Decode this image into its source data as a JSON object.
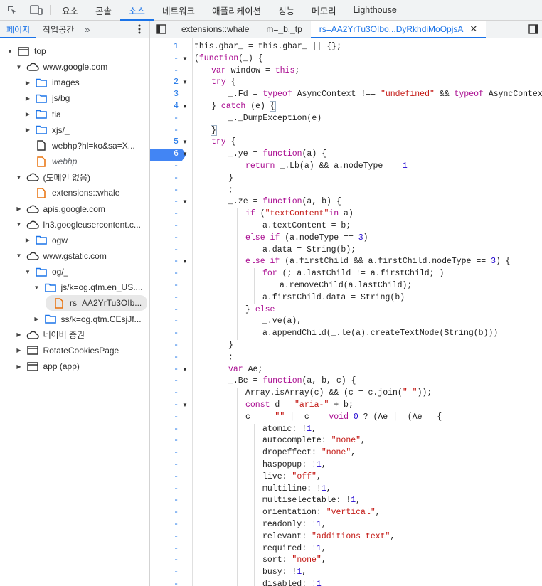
{
  "topbar": {
    "tabs": [
      "요소",
      "콘솔",
      "소스",
      "네트워크",
      "애플리케이션",
      "성능",
      "메모리",
      "Lighthouse"
    ],
    "active_index": 2
  },
  "left_panel": {
    "tabs": [
      "페이지",
      "작업공간"
    ],
    "active_index": 0,
    "more_label": "»"
  },
  "editor_tabs": {
    "files": [
      "extensions::whale",
      "m=_b,_tp",
      "rs=AA2YrTu3OIbo...DyRkhdiMoOpjsA"
    ],
    "active_index": 2,
    "close_label": "✕"
  },
  "tree": [
    {
      "label": "top",
      "icon": "frame-icon",
      "depth": 0,
      "arrow": "down"
    },
    {
      "label": "www.google.com",
      "icon": "cloud-icon",
      "depth": 1,
      "arrow": "down"
    },
    {
      "label": "images",
      "icon": "folder-icon",
      "depth": 2,
      "arrow": "right"
    },
    {
      "label": "js/bg",
      "icon": "folder-icon",
      "depth": 2,
      "arrow": "right"
    },
    {
      "label": "tia",
      "icon": "folder-icon",
      "depth": 2,
      "arrow": "right"
    },
    {
      "label": "xjs/_",
      "icon": "folder-icon",
      "depth": 2,
      "arrow": "right"
    },
    {
      "label": "webhp?hl=ko&sa=X...",
      "icon": "file-icon",
      "depth": 2,
      "arrow": "none"
    },
    {
      "label": "webhp",
      "icon": "script-file-icon",
      "depth": 2,
      "arrow": "none",
      "italic": true
    },
    {
      "label": "(도메인 없음)",
      "icon": "cloud-icon",
      "depth": 1,
      "arrow": "down"
    },
    {
      "label": "extensions::whale",
      "icon": "script-file-icon",
      "depth": 2,
      "arrow": "none"
    },
    {
      "label": "apis.google.com",
      "icon": "cloud-icon",
      "depth": 1,
      "arrow": "right"
    },
    {
      "label": "lh3.googleusercontent.c...",
      "icon": "cloud-icon",
      "depth": 1,
      "arrow": "down"
    },
    {
      "label": "ogw",
      "icon": "folder-icon",
      "depth": 2,
      "arrow": "right"
    },
    {
      "label": "www.gstatic.com",
      "icon": "cloud-icon",
      "depth": 1,
      "arrow": "down"
    },
    {
      "label": "og/_",
      "icon": "folder-icon",
      "depth": 2,
      "arrow": "down"
    },
    {
      "label": "js/k=og.qtm.en_US....",
      "icon": "folder-icon",
      "depth": 3,
      "arrow": "down"
    },
    {
      "label": "rs=AA2YrTu3OIb...",
      "icon": "script-file-icon",
      "depth": 4,
      "arrow": "none",
      "selected": true
    },
    {
      "label": "ss/k=og.qtm.CEsjJf...",
      "icon": "folder-icon",
      "depth": 3,
      "arrow": "right"
    },
    {
      "label": "네이버 증권",
      "icon": "cloud-icon",
      "depth": 1,
      "arrow": "right"
    },
    {
      "label": "RotateCookiesPage",
      "icon": "frame-icon",
      "depth": 1,
      "arrow": "right"
    },
    {
      "label": "app (app)",
      "icon": "frame-icon",
      "depth": 1,
      "arrow": "right"
    }
  ],
  "gutter": [
    {
      "n": "1",
      "fold": ""
    },
    {
      "n": "-",
      "fold": "▼"
    },
    {
      "n": "-",
      "fold": ""
    },
    {
      "n": "2",
      "fold": "▼"
    },
    {
      "n": "3",
      "fold": ""
    },
    {
      "n": "4",
      "fold": "▼"
    },
    {
      "n": "-",
      "fold": ""
    },
    {
      "n": "-",
      "fold": ""
    },
    {
      "n": "5",
      "fold": "▼"
    },
    {
      "n": "6",
      "fold": "▼",
      "breakpoint": true
    },
    {
      "n": "-",
      "fold": ""
    },
    {
      "n": "-",
      "fold": ""
    },
    {
      "n": "-",
      "fold": ""
    },
    {
      "n": "-",
      "fold": "▼"
    },
    {
      "n": "-",
      "fold": ""
    },
    {
      "n": "-",
      "fold": ""
    },
    {
      "n": "-",
      "fold": ""
    },
    {
      "n": "-",
      "fold": ""
    },
    {
      "n": "-",
      "fold": "▼"
    },
    {
      "n": "-",
      "fold": ""
    },
    {
      "n": "-",
      "fold": ""
    },
    {
      "n": "-",
      "fold": ""
    },
    {
      "n": "-",
      "fold": ""
    },
    {
      "n": "-",
      "fold": ""
    },
    {
      "n": "-",
      "fold": ""
    },
    {
      "n": "-",
      "fold": ""
    },
    {
      "n": "-",
      "fold": ""
    },
    {
      "n": "-",
      "fold": "▼"
    },
    {
      "n": "-",
      "fold": ""
    },
    {
      "n": "-",
      "fold": ""
    },
    {
      "n": "-",
      "fold": "▼"
    },
    {
      "n": "-",
      "fold": ""
    },
    {
      "n": "-",
      "fold": ""
    },
    {
      "n": "-",
      "fold": ""
    },
    {
      "n": "-",
      "fold": ""
    },
    {
      "n": "-",
      "fold": ""
    },
    {
      "n": "-",
      "fold": ""
    },
    {
      "n": "-",
      "fold": ""
    },
    {
      "n": "-",
      "fold": ""
    },
    {
      "n": "-",
      "fold": ""
    },
    {
      "n": "-",
      "fold": ""
    },
    {
      "n": "-",
      "fold": ""
    },
    {
      "n": "-",
      "fold": ""
    },
    {
      "n": "-",
      "fold": ""
    },
    {
      "n": "-",
      "fold": ""
    },
    {
      "n": "-",
      "fold": ""
    }
  ],
  "code_lines": [
    {
      "indent": 0,
      "tokens": [
        [
          "this.gbar_ = this.gbar_ || {};",
          ""
        ]
      ]
    },
    {
      "indent": 0,
      "tokens": [
        [
          "(",
          ""
        ],
        [
          "function",
          "kw"
        ],
        [
          "(_) {",
          ""
        ]
      ]
    },
    {
      "indent": 1,
      "tokens": [
        [
          "var",
          "kw"
        ],
        [
          " window = ",
          ""
        ],
        [
          "this",
          "kw"
        ],
        [
          ";",
          ""
        ]
      ]
    },
    {
      "indent": 1,
      "tokens": [
        [
          "try",
          "kw"
        ],
        [
          " {",
          ""
        ]
      ]
    },
    {
      "indent": 2,
      "tokens": [
        [
          "_.Fd = ",
          ""
        ],
        [
          "typeof",
          "kw"
        ],
        [
          " AsyncContext !== ",
          ""
        ],
        [
          "\"undefined\"",
          "str"
        ],
        [
          " && ",
          ""
        ],
        [
          "typeof",
          "kw"
        ],
        [
          " AsyncContext.Snapshot",
          ""
        ]
      ]
    },
    {
      "indent": 1,
      "tokens": [
        [
          "} ",
          ""
        ],
        [
          "catch",
          "kw"
        ],
        [
          " (e) ",
          ""
        ],
        [
          "{",
          "bra"
        ]
      ]
    },
    {
      "indent": 2,
      "tokens": [
        [
          "_._DumpException(e)",
          ""
        ]
      ]
    },
    {
      "indent": 1,
      "tokens": [
        [
          "}",
          "bra"
        ]
      ]
    },
    {
      "indent": 1,
      "tokens": [
        [
          "try",
          "kw"
        ],
        [
          " {",
          ""
        ]
      ]
    },
    {
      "indent": 2,
      "tokens": [
        [
          "_.ye = ",
          ""
        ],
        [
          "function",
          "kw"
        ],
        [
          "(a) {",
          ""
        ]
      ]
    },
    {
      "indent": 3,
      "tokens": [
        [
          "return",
          "kw"
        ],
        [
          " _.Lb(a) && a.nodeType == ",
          ""
        ],
        [
          "1",
          "num2"
        ]
      ]
    },
    {
      "indent": 2,
      "tokens": [
        [
          "}",
          ""
        ]
      ]
    },
    {
      "indent": 2,
      "tokens": [
        [
          ";",
          ""
        ]
      ]
    },
    {
      "indent": 2,
      "tokens": [
        [
          "_.ze = ",
          ""
        ],
        [
          "function",
          "kw"
        ],
        [
          "(a, b) {",
          ""
        ]
      ]
    },
    {
      "indent": 3,
      "tokens": [
        [
          "if",
          "kw"
        ],
        [
          " (",
          ""
        ],
        [
          "\"textContent\"",
          "str"
        ],
        [
          "in",
          "kw"
        ],
        [
          " a)",
          ""
        ]
      ]
    },
    {
      "indent": 4,
      "tokens": [
        [
          "a.textContent = b;",
          ""
        ]
      ]
    },
    {
      "indent": 3,
      "tokens": [
        [
          "else",
          "kw"
        ],
        [
          " ",
          ""
        ],
        [
          "if",
          "kw"
        ],
        [
          " (a.nodeType == ",
          ""
        ],
        [
          "3",
          "num2"
        ],
        [
          ")",
          ""
        ]
      ]
    },
    {
      "indent": 4,
      "tokens": [
        [
          "a.data = String(b);",
          ""
        ]
      ]
    },
    {
      "indent": 3,
      "tokens": [
        [
          "else",
          "kw"
        ],
        [
          " ",
          ""
        ],
        [
          "if",
          "kw"
        ],
        [
          " (a.firstChild && a.firstChild.nodeType == ",
          ""
        ],
        [
          "3",
          "num2"
        ],
        [
          ") {",
          ""
        ]
      ]
    },
    {
      "indent": 4,
      "tokens": [
        [
          "for",
          "kw"
        ],
        [
          " (; a.lastChild != a.firstChild; )",
          ""
        ]
      ]
    },
    {
      "indent": 5,
      "tokens": [
        [
          "a.removeChild(a.lastChild);",
          ""
        ]
      ]
    },
    {
      "indent": 4,
      "tokens": [
        [
          "a.firstChild.data = String(b)",
          ""
        ]
      ]
    },
    {
      "indent": 3,
      "tokens": [
        [
          "} ",
          ""
        ],
        [
          "else",
          "kw"
        ]
      ]
    },
    {
      "indent": 4,
      "tokens": [
        [
          "_.ve(a),",
          ""
        ]
      ]
    },
    {
      "indent": 4,
      "tokens": [
        [
          "a.appendChild(_.le(a).createTextNode(String(b)))",
          ""
        ]
      ]
    },
    {
      "indent": 2,
      "tokens": [
        [
          "}",
          ""
        ]
      ]
    },
    {
      "indent": 2,
      "tokens": [
        [
          ";",
          ""
        ]
      ]
    },
    {
      "indent": 2,
      "tokens": [
        [
          "var",
          "kw"
        ],
        [
          " Ae;",
          ""
        ]
      ]
    },
    {
      "indent": 2,
      "tokens": [
        [
          "_.Be = ",
          ""
        ],
        [
          "function",
          "kw"
        ],
        [
          "(a, b, c) {",
          ""
        ]
      ]
    },
    {
      "indent": 3,
      "tokens": [
        [
          "Array.isArray(c) && (c = c.join(",
          ""
        ],
        [
          "\" \"",
          "str"
        ],
        [
          "));",
          ""
        ]
      ]
    },
    {
      "indent": 3,
      "tokens": [
        [
          "const",
          "kw"
        ],
        [
          " d = ",
          ""
        ],
        [
          "\"aria-\"",
          "str"
        ],
        [
          " + b;",
          ""
        ]
      ]
    },
    {
      "indent": 3,
      "tokens": [
        [
          "c === ",
          ""
        ],
        [
          "\"\"",
          "str"
        ],
        [
          " || c == ",
          ""
        ],
        [
          "void",
          "kw"
        ],
        [
          " ",
          ""
        ],
        [
          "0",
          "num2"
        ],
        [
          " ? (Ae || (Ae = {",
          ""
        ]
      ]
    },
    {
      "indent": 4,
      "tokens": [
        [
          "atomic: !",
          ""
        ],
        [
          "1",
          "num2"
        ],
        [
          ",",
          ""
        ]
      ]
    },
    {
      "indent": 4,
      "tokens": [
        [
          "autocomplete: ",
          ""
        ],
        [
          "\"none\"",
          "str"
        ],
        [
          ",",
          ""
        ]
      ]
    },
    {
      "indent": 4,
      "tokens": [
        [
          "dropeffect: ",
          ""
        ],
        [
          "\"none\"",
          "str"
        ],
        [
          ",",
          ""
        ]
      ]
    },
    {
      "indent": 4,
      "tokens": [
        [
          "haspopup: !",
          ""
        ],
        [
          "1",
          "num2"
        ],
        [
          ",",
          ""
        ]
      ]
    },
    {
      "indent": 4,
      "tokens": [
        [
          "live: ",
          ""
        ],
        [
          "\"off\"",
          "str"
        ],
        [
          ",",
          ""
        ]
      ]
    },
    {
      "indent": 4,
      "tokens": [
        [
          "multiline: !",
          ""
        ],
        [
          "1",
          "num2"
        ],
        [
          ",",
          ""
        ]
      ]
    },
    {
      "indent": 4,
      "tokens": [
        [
          "multiselectable: !",
          ""
        ],
        [
          "1",
          "num2"
        ],
        [
          ",",
          ""
        ]
      ]
    },
    {
      "indent": 4,
      "tokens": [
        [
          "orientation: ",
          ""
        ],
        [
          "\"vertical\"",
          "str"
        ],
        [
          ",",
          ""
        ]
      ]
    },
    {
      "indent": 4,
      "tokens": [
        [
          "readonly: !",
          ""
        ],
        [
          "1",
          "num2"
        ],
        [
          ",",
          ""
        ]
      ]
    },
    {
      "indent": 4,
      "tokens": [
        [
          "relevant: ",
          ""
        ],
        [
          "\"additions text\"",
          "str"
        ],
        [
          ",",
          ""
        ]
      ]
    },
    {
      "indent": 4,
      "tokens": [
        [
          "required: !",
          ""
        ],
        [
          "1",
          "num2"
        ],
        [
          ",",
          ""
        ]
      ]
    },
    {
      "indent": 4,
      "tokens": [
        [
          "sort: ",
          ""
        ],
        [
          "\"none\"",
          "str"
        ],
        [
          ",",
          ""
        ]
      ]
    },
    {
      "indent": 4,
      "tokens": [
        [
          "busy: !",
          ""
        ],
        [
          "1",
          "num2"
        ],
        [
          ",",
          ""
        ]
      ]
    },
    {
      "indent": 4,
      "tokens": [
        [
          "disabled: !",
          ""
        ],
        [
          "1",
          "num2"
        ]
      ]
    }
  ]
}
